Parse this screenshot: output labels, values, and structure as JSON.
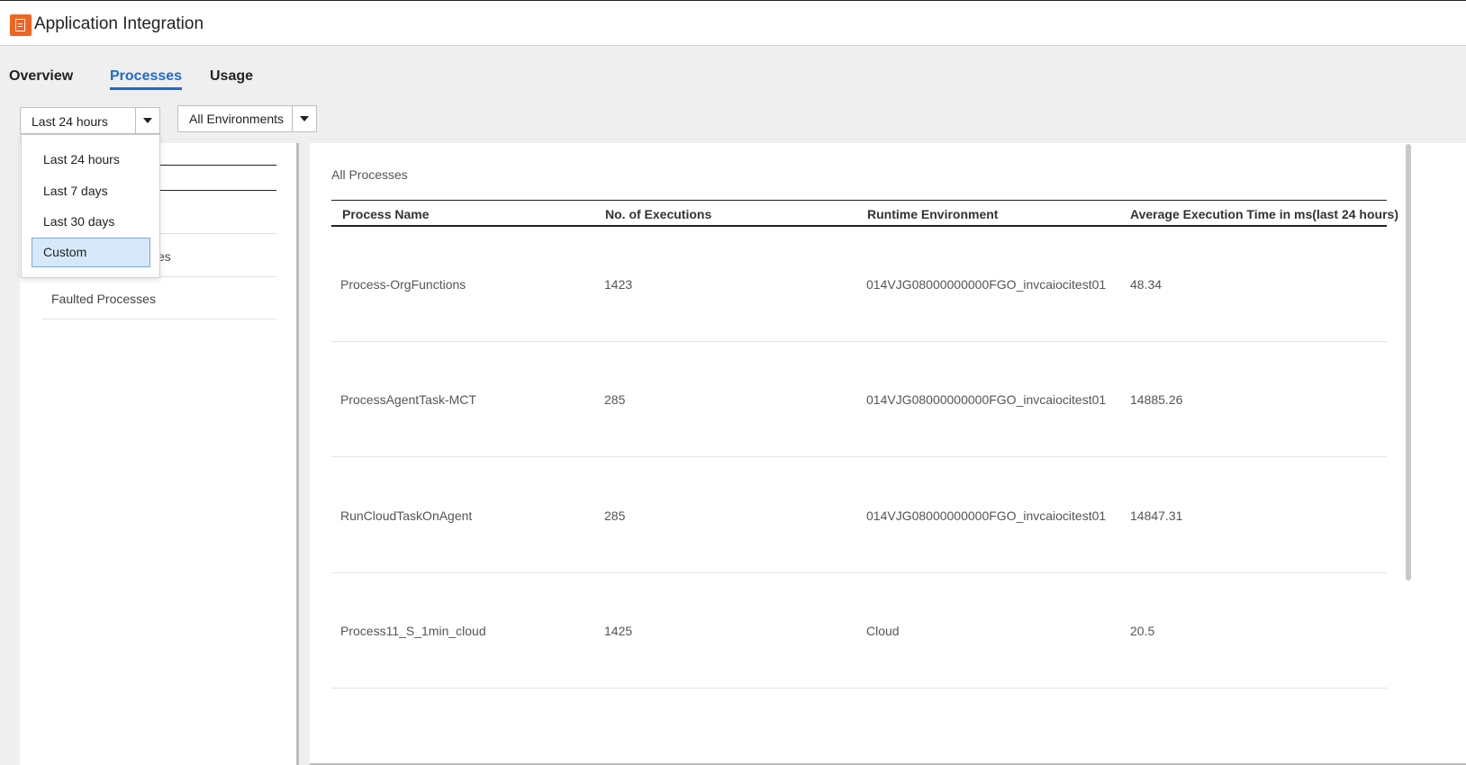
{
  "app": {
    "title": "Application Integration",
    "logo_icon": "document-icon",
    "brand_color": "#f26322"
  },
  "tabs": [
    {
      "label": "Overview",
      "active": false
    },
    {
      "label": "Processes",
      "active": true
    },
    {
      "label": "Usage",
      "active": false
    }
  ],
  "filters": {
    "time_range": {
      "value": "Last 24 hours"
    },
    "environment": {
      "value": "All Environments"
    }
  },
  "time_dropdown": {
    "options": [
      "Last 24 hours",
      "Last 7 days",
      "Last 30 days",
      "Custom"
    ],
    "highlighted": "Custom"
  },
  "left_nav": {
    "items": [
      "es",
      "Faulted Processes"
    ]
  },
  "processes": {
    "title": "All Processes",
    "columns": [
      "Process Name",
      "No. of Executions",
      "Runtime Environment",
      "Average Execution Time in ms(last 24 hours)"
    ],
    "rows": [
      [
        "Process-OrgFunctions",
        "1423",
        "014VJG08000000000FGO_invcaiocitest01",
        "48.34"
      ],
      [
        "ProcessAgentTask-MCT",
        "285",
        "014VJG08000000000FGO_invcaiocitest01",
        "14885.26"
      ],
      [
        "RunCloudTaskOnAgent",
        "285",
        "014VJG08000000000FGO_invcaiocitest01",
        "14847.31"
      ],
      [
        "Process11_S_1min_cloud",
        "1425",
        "Cloud",
        "20.5"
      ]
    ]
  },
  "colors": {
    "accent": "#1e6ad0",
    "selection_bg": "#d6e8fa"
  }
}
